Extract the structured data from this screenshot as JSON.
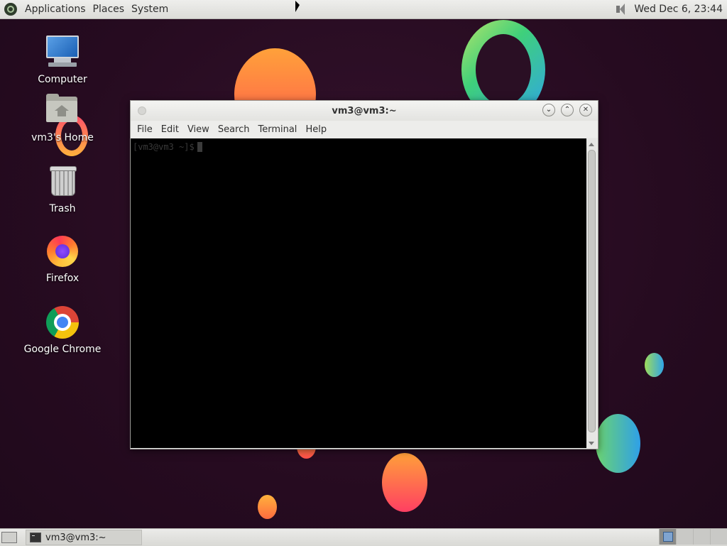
{
  "top_panel": {
    "menus": [
      "Applications",
      "Places",
      "System"
    ],
    "clock": "Wed Dec  6, 23:44"
  },
  "desktop_icons": [
    {
      "label": "Computer",
      "icon": "computer-icon"
    },
    {
      "label": "vm3's Home",
      "icon": "home-folder-icon"
    },
    {
      "label": "Trash",
      "icon": "trash-icon"
    },
    {
      "label": "Firefox",
      "icon": "firefox-icon"
    },
    {
      "label": "Google Chrome",
      "icon": "chrome-icon"
    }
  ],
  "terminal": {
    "title": "vm3@vm3:~",
    "menu": [
      "File",
      "Edit",
      "View",
      "Search",
      "Terminal",
      "Help"
    ],
    "prompt": "[vm3@vm3 ~]$"
  },
  "taskbar": {
    "task_label": "vm3@vm3:~"
  },
  "colors": {
    "desktop_bg": "#2a0f24",
    "terminal_bg": "#000000"
  }
}
